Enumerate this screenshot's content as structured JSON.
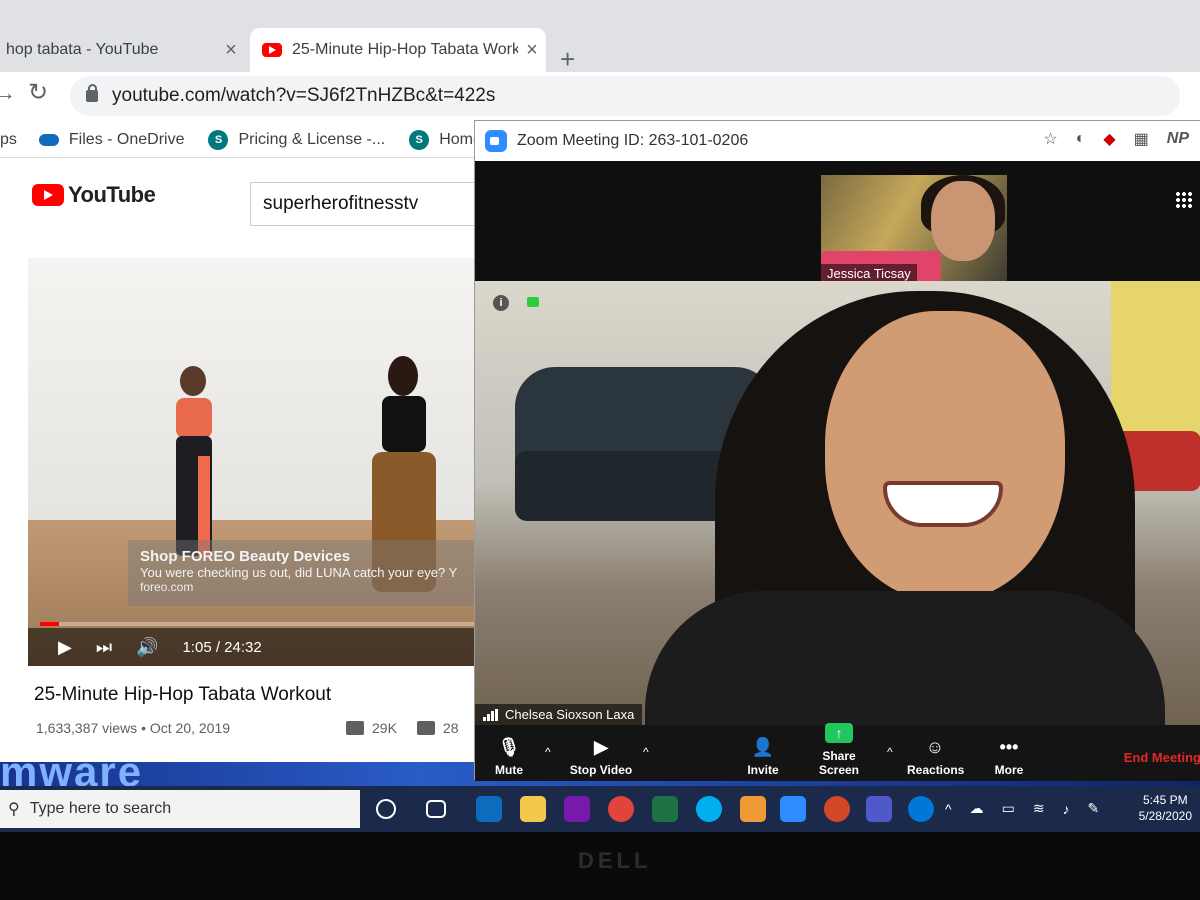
{
  "browser": {
    "tabs": [
      {
        "title": "hop tabata - YouTube",
        "active": false
      },
      {
        "title": "25-Minute Hip-Hop Tabata Work",
        "active": true
      }
    ],
    "url": "youtube.com/watch?v=SJ6f2TnHZBc&t=422s",
    "bookmarks": [
      "ps",
      "Files - OneDrive",
      "Pricing & License -...",
      "Home - f"
    ],
    "toolbar_icons": [
      "star-icon",
      "extension-icon",
      "mcafee-icon",
      "extension-icon-2",
      "profile-NP"
    ],
    "profile_initials": "NP"
  },
  "youtube": {
    "logo_text": "YouTube",
    "search_value": "superherofitnesstv",
    "ad": {
      "headline": "Shop FOREO Beauty Devices",
      "body": "You were checking us out, did LUNA catch your eye? Y",
      "domain": "foreo.com"
    },
    "player": {
      "time": "1:05 / 24:32",
      "progress": 0.044
    },
    "video_title": "25-Minute Hip-Hop Tabata Workout",
    "views_date": "1,633,387 views • Oct 20, 2019",
    "likes": "29K",
    "dislikes": "28"
  },
  "zoom": {
    "title": "Zoom Meeting ID: 263-101-0206",
    "participant_thumb": "Jessica Ticsay",
    "participant_main": "Chelsea Sioxson Laxa",
    "controls": [
      "Mute",
      "Stop Video",
      "Invite",
      "Share Screen",
      "Reactions",
      "More"
    ],
    "end_label": "End Meeting",
    "colors": {
      "share": "#22c55e",
      "end": "#e02828",
      "accent": "#2d8cff"
    }
  },
  "desktop": {
    "wallpaper_text": "mware"
  },
  "taskbar": {
    "search_placeholder": "Type here to search",
    "time": "5:45 PM",
    "date": "5/28/2020"
  },
  "laptop_brand": "DELL"
}
